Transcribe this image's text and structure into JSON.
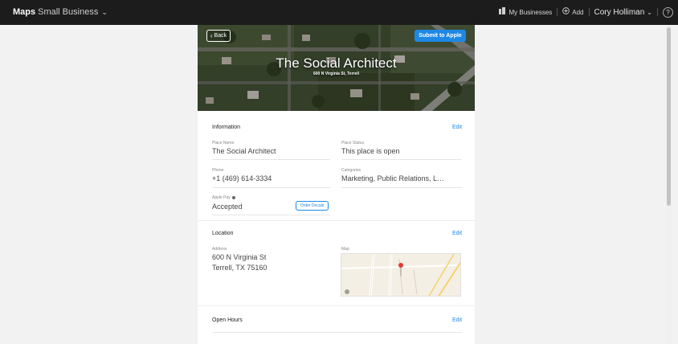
{
  "topbar": {
    "apple_logo": "",
    "maps_label": "Maps",
    "product_label": "Small Business",
    "product_chevron": "⌄",
    "my_businesses_label": "My Businesses",
    "add_label": "Add",
    "user_name": "Cory Holliman",
    "user_chevron": "⌄",
    "help_label": "?"
  },
  "hero": {
    "back_label": "Back",
    "submit_label": "Submit to Apple",
    "title": "The Social Architect",
    "address": "600 N Virginia St, Terrell"
  },
  "information": {
    "title": "Information",
    "edit_label": "Edit",
    "place_name_label": "Place Name",
    "place_name_value": "The Social Architect",
    "place_status_label": "Place Status",
    "place_status_value": "This place is open",
    "phone_label": "Phone",
    "phone_value": "+1 (469) 614-3334",
    "categories_label": "Categories",
    "categories_value": "Marketing, Public Relations, L…",
    "apple_pay_label": "Apple Pay",
    "apple_pay_value": "Accepted",
    "order_decals_label": "Order Decals"
  },
  "location": {
    "title": "Location",
    "edit_label": "Edit",
    "address_label": "Address",
    "address_line1": "600 N Virginia St",
    "address_line2": "Terrell, TX 75160",
    "map_label": "Map"
  },
  "open_hours": {
    "title": "Open Hours",
    "edit_label": "Edit"
  },
  "colors": {
    "accent": "#1e88e5",
    "topbar_bg": "#1c1c1c",
    "page_bg": "#f2f2f2",
    "pin": "#e53935"
  },
  "icons": {
    "businesses_icon": "building-icon",
    "add_icon": "plus-circle-icon",
    "help_icon": "question-circle-icon",
    "back_icon": "chevron-left-icon",
    "info_icon": "info-icon",
    "map_pin_icon": "map-pin-icon",
    "map_apple_icon": "apple-logo-icon"
  }
}
